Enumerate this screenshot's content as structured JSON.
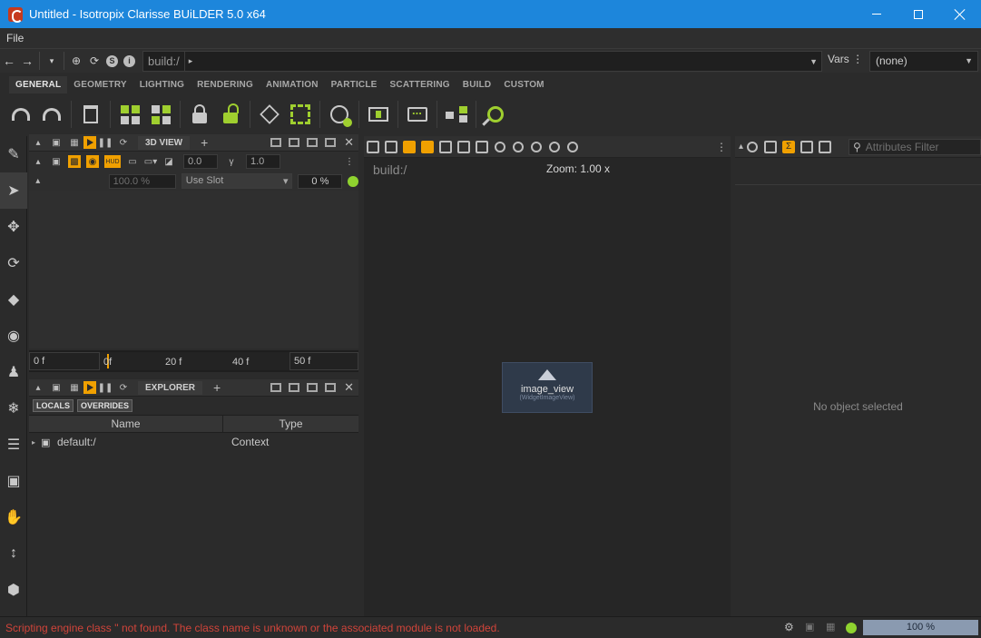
{
  "window": {
    "title": "Untitled - Isotropix Clarisse BUiLDER 5.0 x64"
  },
  "menu": {
    "items": [
      "File"
    ]
  },
  "address": {
    "path": "build:/",
    "vars_label": "Vars",
    "vars_value": "(none)"
  },
  "shelf": {
    "tabs": [
      "GENERAL",
      "GEOMETRY",
      "LIGHTING",
      "RENDERING",
      "ANIMATION",
      "PARTICLE",
      "SCATTERING",
      "BUILD",
      "CUSTOM"
    ],
    "active_tab": "GENERAL"
  },
  "view3d": {
    "title": "3D VIEW",
    "field_a": "0.0",
    "field_b": "1.0",
    "field_c": "100.0 %",
    "slot": "Use Slot",
    "percent": "0 %"
  },
  "timeline": {
    "start": "0 f",
    "cursor": "0f",
    "t20": "20 f",
    "t40": "40 f",
    "end": "50 f"
  },
  "explorer": {
    "title": "EXPLORER",
    "toggles": [
      "LOCALS",
      "OVERRIDES"
    ],
    "columns": [
      "Name",
      "Type"
    ],
    "rows": [
      {
        "name": "default:/",
        "type": "Context"
      }
    ]
  },
  "viewer": {
    "path": "build:/",
    "zoom": "Zoom: 1.00 x",
    "widget_title": "image_view",
    "widget_sub": "(WidgetImageView)"
  },
  "attributes": {
    "filter_placeholder": "Attributes Filter",
    "empty": "No object selected"
  },
  "status": {
    "message": "Scripting engine class '' not found. The class name is unknown or the associated module is not loaded.",
    "progress": "100 %"
  },
  "colors": {
    "accent": "#f0a000",
    "titlebar": "#1d86db",
    "highlight": "#9fcf2f",
    "error": "#d0443a"
  }
}
